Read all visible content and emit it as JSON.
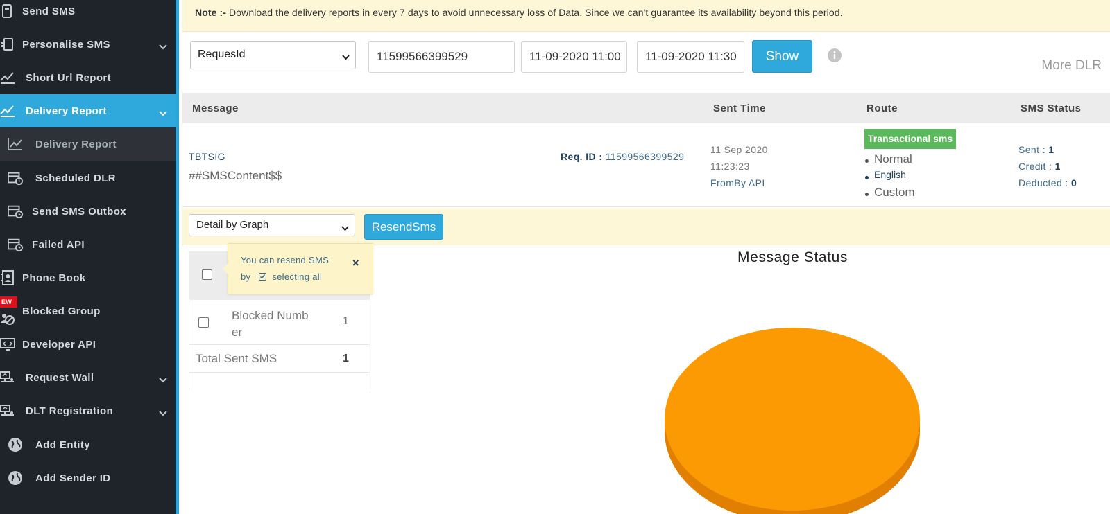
{
  "sidebar": {
    "items": [
      {
        "label": "Send SMS",
        "icon": "send-sms-icon"
      },
      {
        "label": "Personalise SMS",
        "icon": "personalise-icon"
      },
      {
        "label": "Short Url Report",
        "icon": "chart-line-icon"
      },
      {
        "label": "Delivery Report",
        "icon": "chart-line-icon"
      },
      {
        "label": "Delivery Report",
        "icon": "chart-line-icon"
      },
      {
        "label": "Scheduled DLR",
        "icon": "calendar-clock-icon"
      },
      {
        "label": "Send SMS Outbox",
        "icon": "calendar-clock-icon"
      },
      {
        "label": "Failed API",
        "icon": "calendar-clock-icon"
      },
      {
        "label": "Phone Book",
        "icon": "contact-book-icon"
      },
      {
        "label": "Blocked Group",
        "icon": "blocked-group-icon"
      },
      {
        "label": "Developer API",
        "icon": "monitor-code-icon"
      },
      {
        "label": "Request Wall",
        "icon": "network-icon"
      },
      {
        "label": "DLT Registration",
        "icon": "network-icon"
      },
      {
        "label": "Add Entity",
        "icon": "globe-icon"
      },
      {
        "label": "Add Sender ID",
        "icon": "globe-icon"
      }
    ],
    "new_badge": "EW"
  },
  "note": {
    "prefix": "Note :-",
    "text": "Download the delivery reports in every 7 days to avoid unnecessary loss of Data. Since we can't guarantee its availability beyond this period."
  },
  "filter": {
    "type_select": "RequesId",
    "request_id": "11599566399529",
    "from_date": "11-09-2020 11:00",
    "to_date": "11-09-2020 11:30",
    "show_label": "Show",
    "more_dlr": "More DLR"
  },
  "table": {
    "headers": {
      "message": "Message",
      "sent_time": "Sent Time",
      "route": "Route",
      "sms_status": "SMS Status"
    },
    "row": {
      "sender": "TBTSIG",
      "content": "##SMSContent$$",
      "req_label": "Req. ID :",
      "req_id": "11599566399529",
      "date": "11 Sep 2020",
      "time": "11:23:23",
      "via": "FromBy API",
      "route_badge": "Transactional sms",
      "route_items": [
        "Normal",
        "English",
        "Custom"
      ],
      "sent_label": "Sent :",
      "sent_value": "1",
      "credit_label": "Credit :",
      "credit_value": "1",
      "deducted_label": "Deducted :",
      "deducted_value": "0"
    }
  },
  "actions": {
    "detail_select": "Detail by Graph",
    "resend_label": "ResendSms"
  },
  "tooltip": {
    "line1": "You can resend SMS",
    "line2_prefix": "by",
    "line2_suffix": "selecting all",
    "close": "×"
  },
  "summary_table": {
    "rows": [
      {
        "label_line1": "Blocked Numb",
        "label_line2": "er",
        "value": "1"
      },
      {
        "label": "Total Sent SMS",
        "value": "1"
      }
    ]
  },
  "chart_data": {
    "type": "pie",
    "title": "Message Status",
    "categories": [
      "Blocked Number"
    ],
    "values": [
      1
    ],
    "colors": [
      "#fb9a02"
    ]
  },
  "colors": {
    "sidebar_bg": "#1f242b",
    "accent": "#2fa9db",
    "note_bg": "#fdf7d8",
    "route_badge": "#5cb85c",
    "pie": "#fb9a02"
  }
}
